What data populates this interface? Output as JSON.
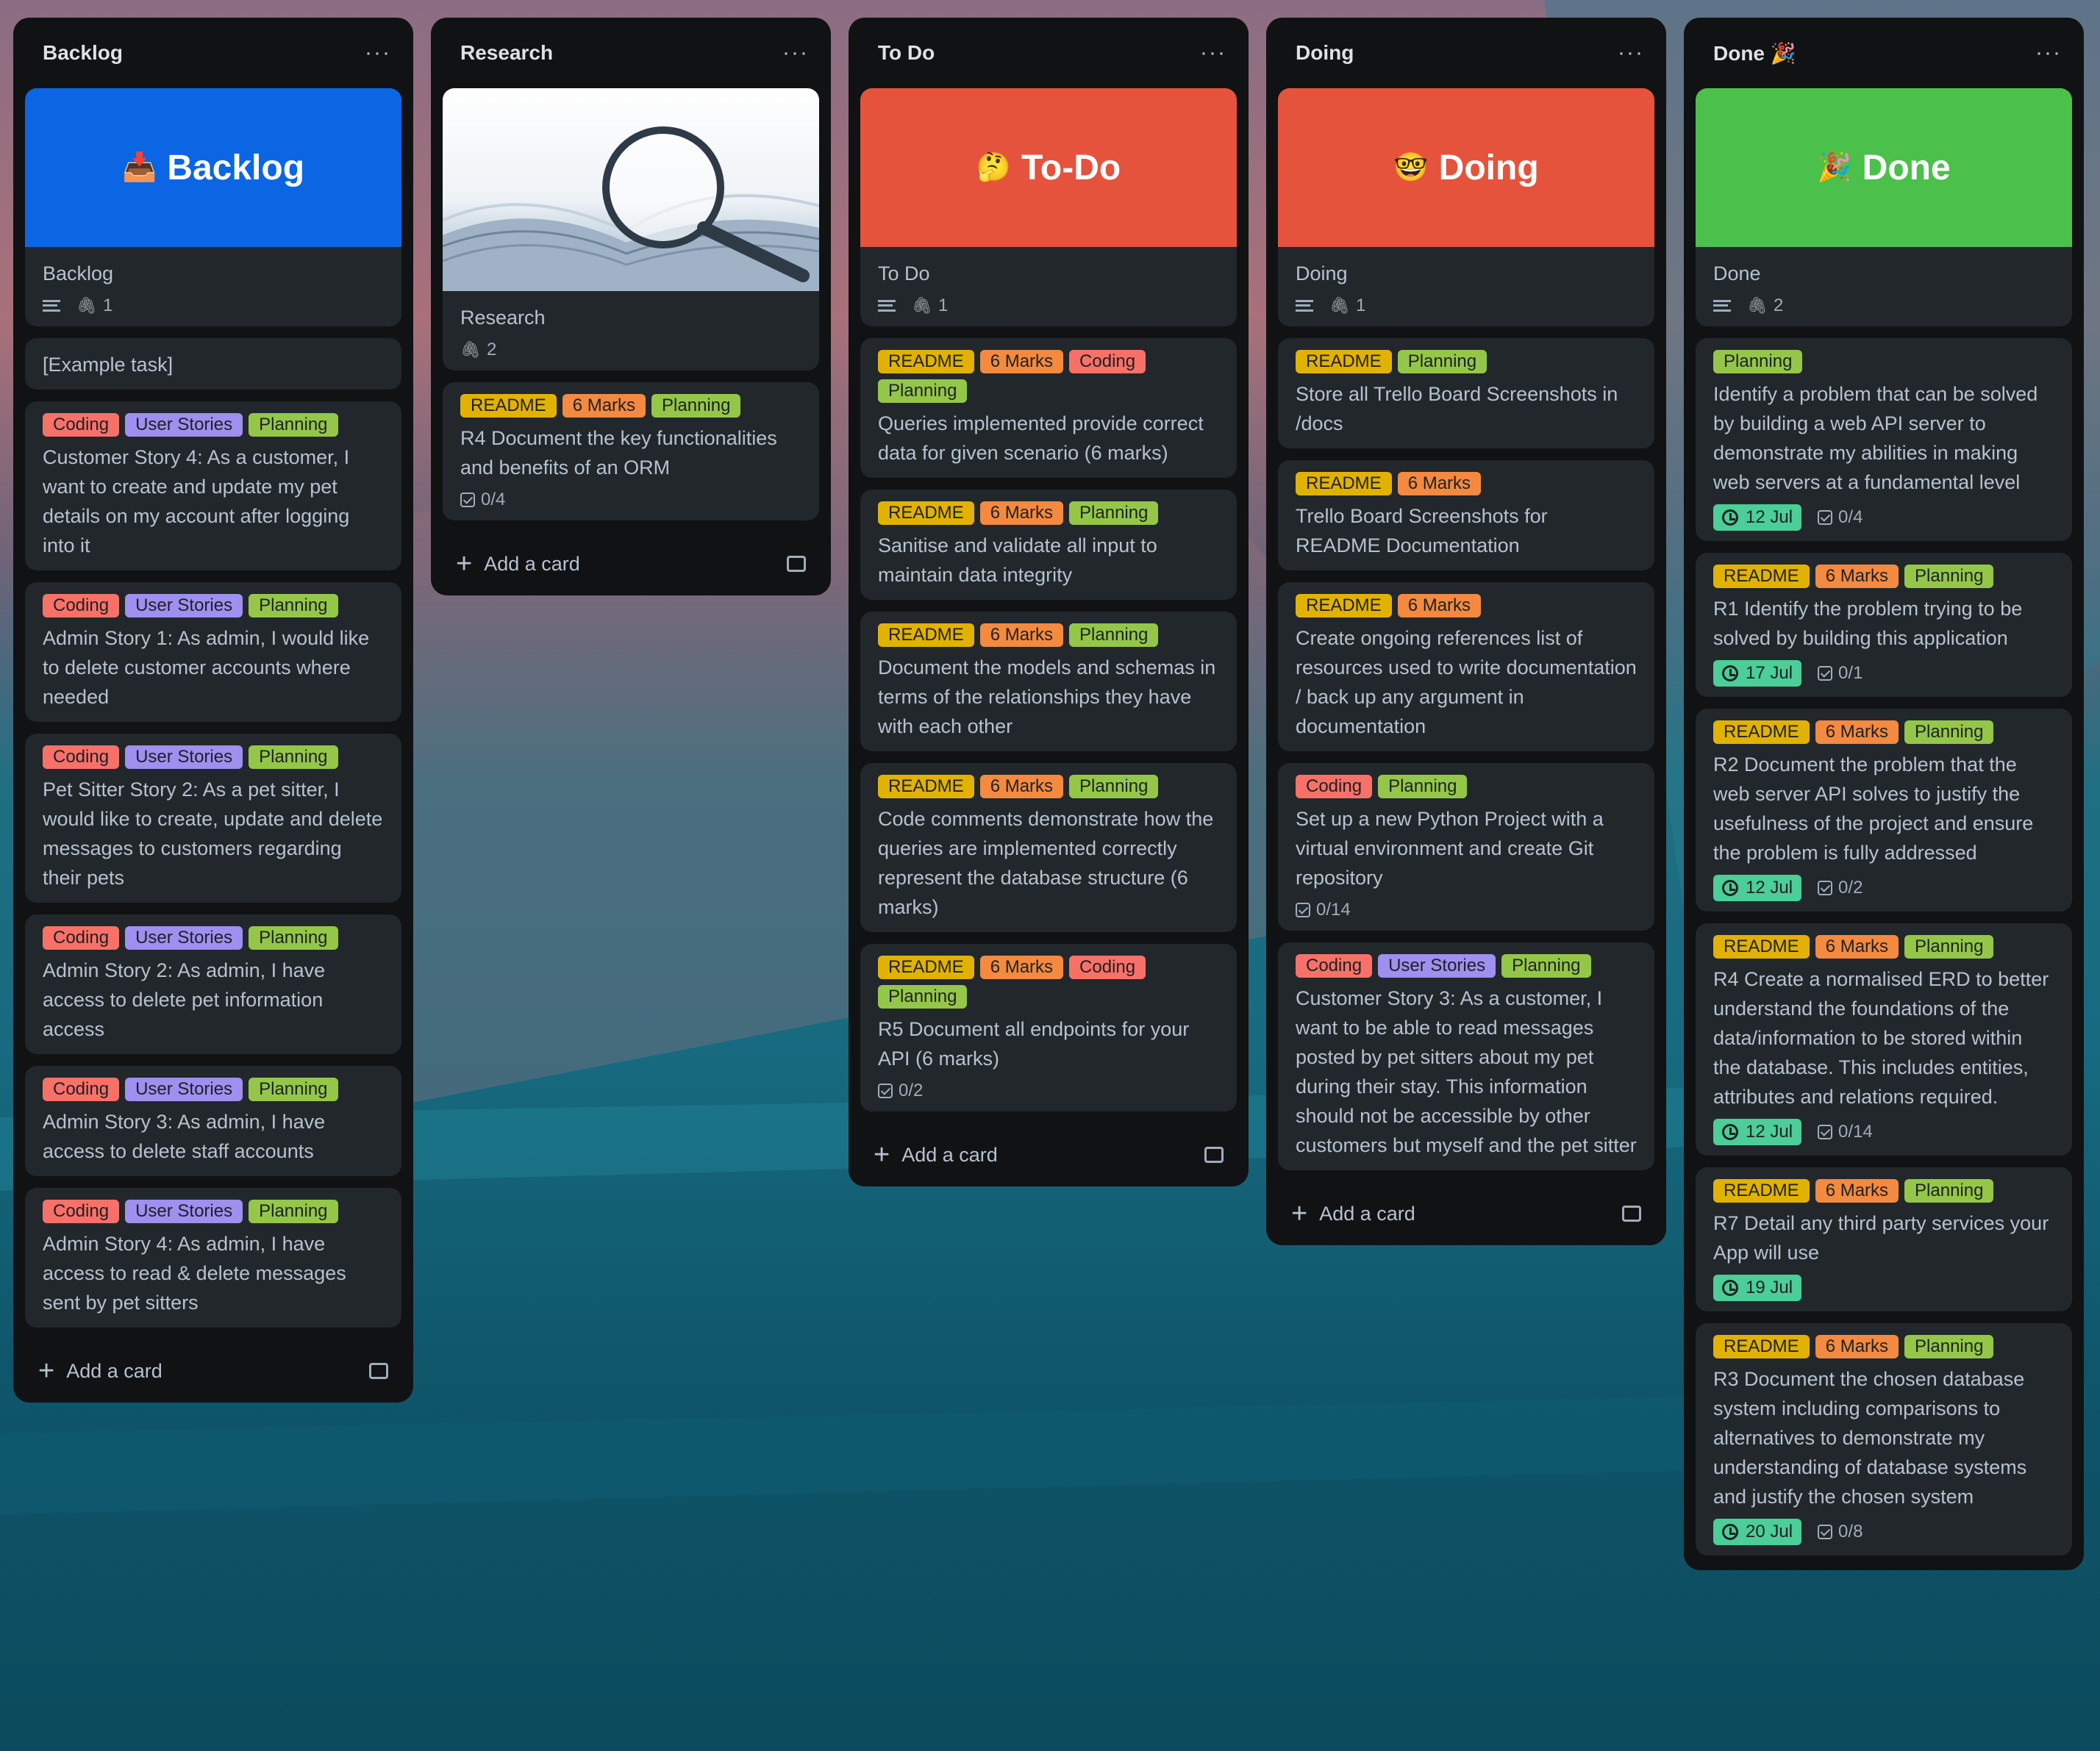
{
  "board": {
    "lists": [
      {
        "title": "Backlog",
        "menu": "···",
        "cover_card": {
          "cover_emoji": "📥",
          "cover_text": "Backlog",
          "title": "Backlog",
          "attachments": "1"
        },
        "cards": [
          {
            "labels": [],
            "title": "[Example task]"
          },
          {
            "labels": [
              "Coding",
              "User Stories",
              "Planning"
            ],
            "title": "Customer Story 4: As a customer, I want to create and update my pet details on my account after logging into it"
          },
          {
            "labels": [
              "Coding",
              "User Stories",
              "Planning"
            ],
            "title": "Admin Story 1: As admin, I would like to delete customer accounts where needed"
          },
          {
            "labels": [
              "Coding",
              "User Stories",
              "Planning"
            ],
            "title": "Pet Sitter Story 2: As a pet sitter, I would like to create, update and delete messages to customers regarding their pets"
          },
          {
            "labels": [
              "Coding",
              "User Stories",
              "Planning"
            ],
            "title": "Admin Story 2: As admin, I have access to delete pet information access"
          },
          {
            "labels": [
              "Coding",
              "User Stories",
              "Planning"
            ],
            "title": "Admin Story 3: As admin, I have access to delete staff accounts"
          },
          {
            "labels": [
              "Coding",
              "User Stories",
              "Planning"
            ],
            "title": "Admin Story 4: As admin, I have access to read & delete messages sent by pet sitters"
          }
        ],
        "add_card": "Add a card"
      },
      {
        "title": "Research",
        "menu": "···",
        "image_card": {
          "title": "Research",
          "attachments": "2"
        },
        "cards": [
          {
            "labels": [
              "README",
              "6 Marks",
              "Planning"
            ],
            "title": "R4 Document the key functionalities and benefits of an ORM",
            "checklist": "0/4"
          }
        ],
        "add_card": "Add a card"
      },
      {
        "title": "To Do",
        "menu": "···",
        "cover_card": {
          "cover_emoji": "🤔",
          "cover_text": "To-Do",
          "title": "To Do",
          "attachments": "1"
        },
        "cards": [
          {
            "labels": [
              "README",
              "6 Marks",
              "Coding",
              "Planning"
            ],
            "title": "Queries implemented provide correct data for given scenario (6 marks)"
          },
          {
            "labels": [
              "README",
              "6 Marks",
              "Planning"
            ],
            "title": "Sanitise and validate all input to maintain data integrity"
          },
          {
            "labels": [
              "README",
              "6 Marks",
              "Planning"
            ],
            "title": "Document the models and schemas in terms of the relationships they have with each other"
          },
          {
            "labels": [
              "README",
              "6 Marks",
              "Planning"
            ],
            "title": "Code comments demonstrate how the queries are implemented correctly represent the database structure (6 marks)"
          },
          {
            "labels": [
              "README",
              "6 Marks",
              "Coding",
              "Planning"
            ],
            "title": "R5 Document all endpoints for your API (6 marks)",
            "checklist": "0/2"
          }
        ],
        "add_card": "Add a card"
      },
      {
        "title": "Doing",
        "menu": "···",
        "cover_card": {
          "cover_emoji": "🤓",
          "cover_text": "Doing",
          "title": "Doing",
          "attachments": "1"
        },
        "cards": [
          {
            "labels": [
              "README",
              "Planning"
            ],
            "title": "Store all Trello Board Screenshots in /docs"
          },
          {
            "labels": [
              "README",
              "6 Marks"
            ],
            "title": "Trello Board Screenshots for README Documentation"
          },
          {
            "labels": [
              "README",
              "6 Marks"
            ],
            "title": "Create ongoing references list of resources used to write documentation / back up any argument in documentation"
          },
          {
            "labels": [
              "Coding",
              "Planning"
            ],
            "title": "Set up a new Python Project with a virtual environment and create Git repository",
            "checklist": "0/14"
          },
          {
            "labels": [
              "Coding",
              "User Stories",
              "Planning"
            ],
            "title": "Customer Story 3: As a customer, I want to be able to read messages posted by pet sitters about my pet during their stay. This information should not be accessible by other customers but myself and the pet sitter"
          }
        ],
        "add_card": "Add a card"
      },
      {
        "title": "Done 🎉",
        "menu": "···",
        "cover_card": {
          "cover_emoji": "🎉",
          "cover_text": "Done",
          "title": "Done",
          "attachments": "2"
        },
        "cards": [
          {
            "labels": [
              "Planning"
            ],
            "title": "Identify a problem that can be solved by building a web API server to demonstrate my abilities in making web servers at a fundamental level",
            "due": "12 Jul",
            "checklist": "0/4"
          },
          {
            "labels": [
              "README",
              "6 Marks",
              "Planning"
            ],
            "title": "R1 Identify the problem trying to be solved by building this application",
            "due": "17 Jul",
            "checklist": "0/1"
          },
          {
            "labels": [
              "README",
              "6 Marks",
              "Planning"
            ],
            "title": "R2 Document the problem that the web server API solves to justify the usefulness of the project and ensure the problem is fully addressed",
            "due": "12 Jul",
            "checklist": "0/2"
          },
          {
            "labels": [
              "README",
              "6 Marks",
              "Planning"
            ],
            "title": "R4 Create a normalised ERD to better understand the foundations of the data/information to be stored within the database. This includes entities, attributes and relations required.",
            "due": "12 Jul",
            "checklist": "0/14"
          },
          {
            "labels": [
              "README",
              "6 Marks",
              "Planning"
            ],
            "title": "R7 Detail any third party services your App will use",
            "due": "19 Jul"
          },
          {
            "labels": [
              "README",
              "6 Marks",
              "Planning"
            ],
            "title": "R3 Document the chosen database system including comparisons to alternatives to demonstrate my understanding of database systems and justify the chosen system",
            "due": "20 Jul",
            "checklist": "0/8"
          }
        ]
      }
    ],
    "colors": {
      "backlog_cover": "#0c66e4",
      "todo_cover": "#e5533d",
      "doing_cover": "#e5533d",
      "done_cover": "#4bc04b",
      "readme_label": "#e2b203",
      "marks_label": "#f38a3f",
      "coding_label": "#f87168",
      "user_stories_label": "#9f8fef",
      "planning_label": "#94c748",
      "due_badge": "#4bce97"
    }
  }
}
